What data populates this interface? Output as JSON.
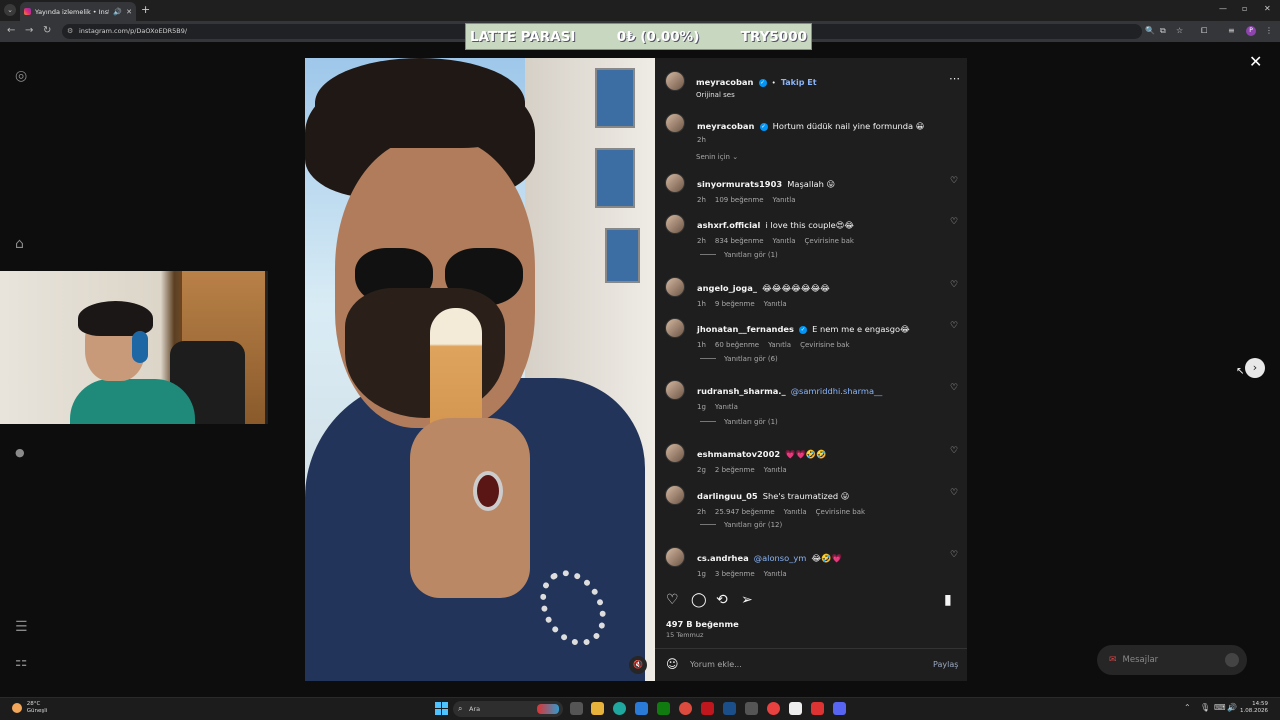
{
  "browser": {
    "tab_title": "Yayında izlemelik • Instagram",
    "url": "instagram.com/p/DaOXoEDR5B9/",
    "profile_initial": "P"
  },
  "overlay": {
    "label": "LATTE PARASI",
    "amount": "0₺ (0.00%)",
    "goal": "TRY5000"
  },
  "post": {
    "author": "meyracoban",
    "follow": "Takip Et",
    "audio": "Orijinal ses",
    "caption_user": "meyracoban",
    "caption": "Hortum düdük nail yine formunda 😀",
    "caption_time": "2h",
    "sort_label": "Senin için",
    "likes": "497 B beğenme",
    "date": "15 Temmuz",
    "comment_placeholder": "Yorum ekle...",
    "share": "Paylaş"
  },
  "comments": [
    {
      "user": "sinyormurats1903",
      "text": "Maşallah 😛",
      "time": "2h",
      "likes": "109 beğenme",
      "reply": "Yanıtla",
      "translate": "",
      "verified": false,
      "mention": ""
    },
    {
      "user": "ashxrf.official",
      "text": "i love this couple😍😂",
      "time": "2h",
      "likes": "834 beğenme",
      "reply": "Yanıtla",
      "translate": "Çevirisine bak",
      "verified": false,
      "mention": "",
      "view_replies": "Yanıtları gör (1)"
    },
    {
      "user": "angelo_joga_",
      "text": "😂😂😂😂😂😂😂",
      "time": "1h",
      "likes": "9 beğenme",
      "reply": "Yanıtla",
      "translate": "",
      "verified": false,
      "mention": ""
    },
    {
      "user": "jhonatan__fernandes",
      "text": "E nem me e engasgo😂",
      "time": "1h",
      "likes": "60 beğenme",
      "reply": "Yanıtla",
      "translate": "Çevirisine bak",
      "verified": true,
      "mention": "",
      "view_replies": "Yanıtları gör (6)"
    },
    {
      "user": "rudransh_sharma._",
      "text": "",
      "time": "1g",
      "likes": "",
      "reply": "Yanıtla",
      "translate": "",
      "verified": false,
      "mention": "@samriddhi.sharma__",
      "view_replies": "Yanıtları gör (1)"
    },
    {
      "user": "eshmamatov2002",
      "text": "💗💗🤣🤣",
      "time": "2g",
      "likes": "2 beğenme",
      "reply": "Yanıtla",
      "translate": "",
      "verified": false,
      "mention": ""
    },
    {
      "user": "darlinguu_05",
      "text": "She's traumatized 😛",
      "time": "2h",
      "likes": "25.947 beğenme",
      "reply": "Yanıtla",
      "translate": "Çevirisine bak",
      "verified": false,
      "mention": "",
      "view_replies": "Yanıtları gör (12)"
    },
    {
      "user": "cs.andrhea",
      "text": "😂🤣💗",
      "time": "1g",
      "likes": "3 beğenme",
      "reply": "Yanıtla",
      "translate": "",
      "verified": false,
      "mention": "@alonso_ym"
    }
  ],
  "messages": {
    "label": "Mesajlar"
  },
  "taskbar": {
    "temp": "28°C",
    "weather": "Güneşli",
    "search": "Ara",
    "time": "14:59",
    "date": "1.08.2026"
  },
  "colors": {
    "accent": "#0095f6",
    "link": "#8ab4f8",
    "panel": "#1e1e1e"
  }
}
